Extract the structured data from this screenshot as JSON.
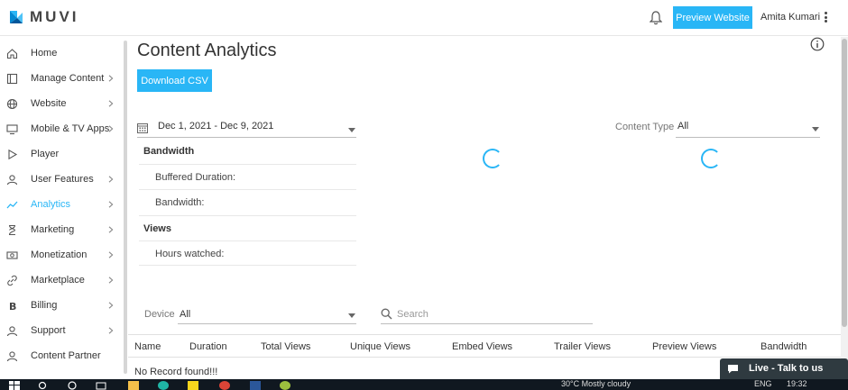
{
  "header": {
    "logo_text": "MUVI",
    "preview_label": "Preview Website",
    "user_name": "Amita Kumari"
  },
  "sidebar": {
    "items": [
      {
        "label": "Home",
        "icon": "home-icon",
        "chevron": false
      },
      {
        "label": "Manage Content",
        "icon": "content-icon",
        "chevron": true
      },
      {
        "label": "Website",
        "icon": "globe-icon",
        "chevron": true
      },
      {
        "label": "Mobile & TV Apps",
        "icon": "monitor-icon",
        "chevron": true
      },
      {
        "label": "Player",
        "icon": "play-icon",
        "chevron": false
      },
      {
        "label": "User Features",
        "icon": "user-icon",
        "chevron": true
      },
      {
        "label": "Analytics",
        "icon": "analytics-icon",
        "chevron": true,
        "active": true
      },
      {
        "label": "Marketing",
        "icon": "hourglass-icon",
        "chevron": true
      },
      {
        "label": "Monetization",
        "icon": "money-icon",
        "chevron": true
      },
      {
        "label": "Marketplace",
        "icon": "link-icon",
        "chevron": true
      },
      {
        "label": "Billing",
        "icon": "bitcoin-icon",
        "chevron": true
      },
      {
        "label": "Support",
        "icon": "support-icon",
        "chevron": true
      },
      {
        "label": "Content Partner",
        "icon": "partner-icon",
        "chevron": false
      }
    ],
    "active_color": "#29b6f6"
  },
  "main": {
    "title": "Content Analytics",
    "download_csv": "Download CSV",
    "date_range": "Dec 1, 2021 - Dec 9, 2021",
    "bandwidth_heading": "Bandwidth",
    "buffered_duration_label": "Buffered Duration:",
    "bandwidth_label": "Bandwidth:",
    "views_heading": "Views",
    "hours_watched_label": "Hours watched:",
    "content_type_label": "Content Type",
    "content_type_value": "All",
    "device_label": "Device",
    "device_value": "All",
    "search_placeholder": "Search",
    "table_columns": [
      "Name",
      "Duration",
      "Total Views",
      "Unique Views",
      "Embed Views",
      "Trailer Views",
      "Preview Views",
      "Bandwidth"
    ],
    "no_record": "No Record found!!!"
  },
  "live_chat": {
    "label": "Live - Talk to us"
  },
  "taskbar": {
    "time": "19:32",
    "lang": "ENG",
    "weather": "30°C  Mostly cloudy"
  },
  "colors": {
    "accent": "#29b6f6",
    "chat_bg": "#2f3a40",
    "taskbar_bg": "#101820"
  }
}
